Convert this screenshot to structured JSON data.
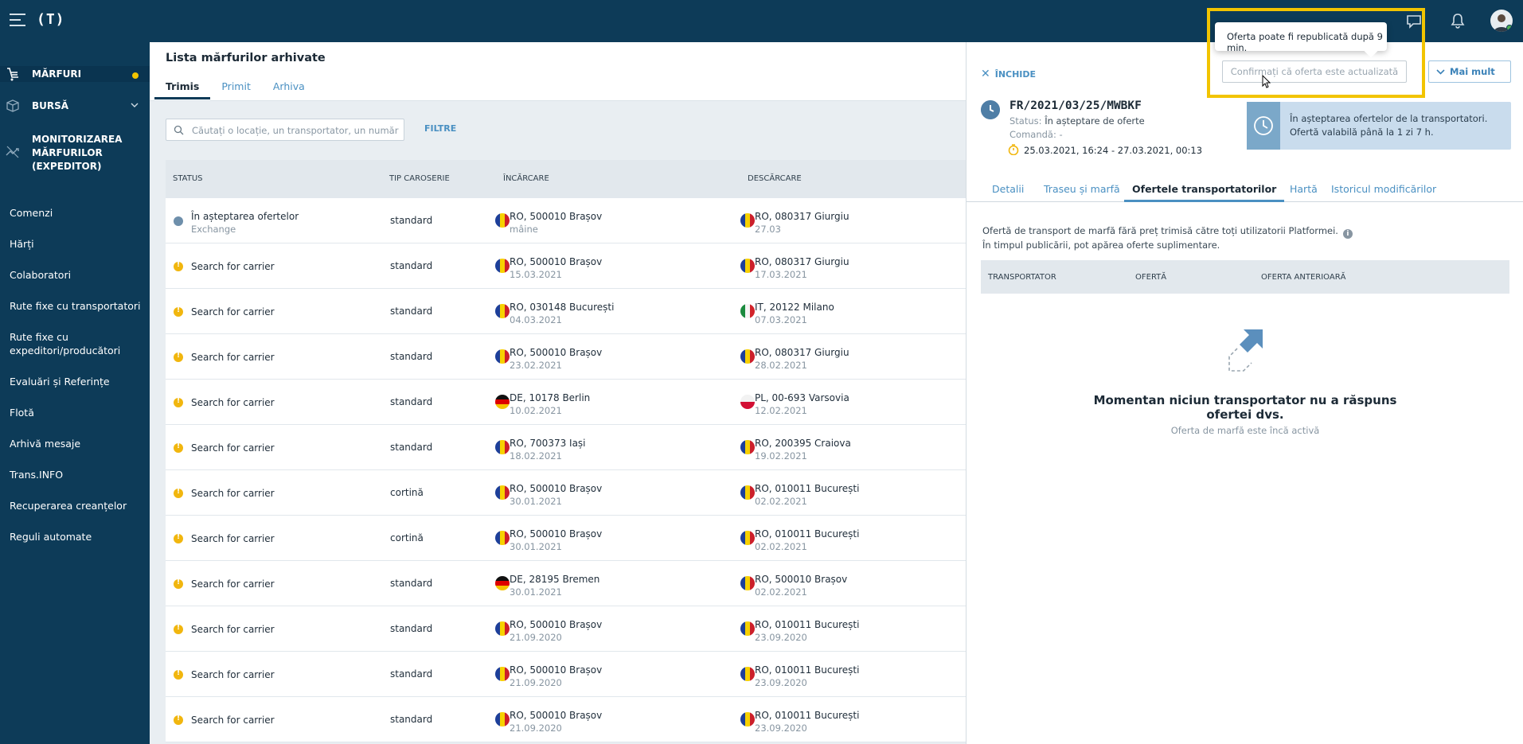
{
  "app": {
    "logo": "(T)"
  },
  "sidebar": {
    "main": [
      {
        "label": "MĂRFURI"
      },
      {
        "label": "BURSĂ"
      },
      {
        "label": "MONITORIZAREA MĂRFURILOR (EXPEDITOR)"
      }
    ],
    "items": [
      {
        "label": "Comenzi"
      },
      {
        "label": "Hărți"
      },
      {
        "label": "Colaboratori"
      },
      {
        "label": "Rute fixe cu transportatori"
      },
      {
        "label": "Rute fixe cu expeditori/producători"
      },
      {
        "label": "Evaluări și Referințe"
      },
      {
        "label": "Flotă"
      },
      {
        "label": "Arhivă mesaje"
      },
      {
        "label": "Trans.INFO"
      },
      {
        "label": "Recuperarea creanțelor"
      },
      {
        "label": "Reguli automate"
      }
    ]
  },
  "main": {
    "title": "Lista mărfurilor arhivate",
    "tabs": [
      "Trimis",
      "Primit",
      "Arhiva"
    ],
    "search_placeholder": "Căutați o locație, un transportator, un număr de...",
    "filter_label": "FILTRE",
    "columns": [
      "STATUS",
      "TIP CAROSERIE",
      "ÎNCĂRCARE",
      "DESCĂRCARE"
    ],
    "rows": [
      {
        "status": "În așteptarea ofertelor",
        "status_sub": "Exchange",
        "body": "standard",
        "load": "RO, 500010 Brașov",
        "load_date": "mâine",
        "unload": "RO, 080317 Giurgiu",
        "unload_date": "27.03"
      },
      {
        "status": "Search for carrier",
        "body": "standard",
        "load": "RO, 500010 Brașov",
        "load_date": "15.03.2021",
        "unload": "RO, 080317 Giurgiu",
        "unload_date": "17.03.2021"
      },
      {
        "status": "Search for carrier",
        "body": "standard",
        "load": "RO, 030148 București",
        "load_date": "04.03.2021",
        "unload": "IT, 20122 Milano",
        "unload_date": "07.03.2021"
      },
      {
        "status": "Search for carrier",
        "body": "standard",
        "load": "RO, 500010 Brașov",
        "load_date": "23.02.2021",
        "unload": "RO, 080317 Giurgiu",
        "unload_date": "28.02.2021"
      },
      {
        "status": "Search for carrier",
        "body": "standard",
        "load": "DE, 10178 Berlin",
        "load_date": "10.02.2021",
        "unload": "PL, 00-693 Varsovia",
        "unload_date": "12.02.2021"
      },
      {
        "status": "Search for carrier",
        "body": "standard",
        "load": "RO, 700373 Iași",
        "load_date": "18.02.2021",
        "unload": "RO, 200395 Craiova",
        "unload_date": "19.02.2021"
      },
      {
        "status": "Search for carrier",
        "body": "cortină",
        "load": "RO, 500010 Brașov",
        "load_date": "30.01.2021",
        "unload": "RO, 010011 București",
        "unload_date": "02.02.2021"
      },
      {
        "status": "Search for carrier",
        "body": "cortină",
        "load": "RO, 500010 Brașov",
        "load_date": "30.01.2021",
        "unload": "RO, 010011 București",
        "unload_date": "02.02.2021"
      },
      {
        "status": "Search for carrier",
        "body": "standard",
        "load": "DE, 28195 Bremen",
        "load_date": "30.01.2021",
        "unload": "RO, 500010 Brașov",
        "unload_date": "02.02.2021"
      },
      {
        "status": "Search for carrier",
        "body": "standard",
        "load": "RO, 500010 Brașov",
        "load_date": "21.09.2020",
        "unload": "RO, 010011 București",
        "unload_date": "23.09.2020"
      },
      {
        "status": "Search for carrier",
        "body": "standard",
        "load": "RO, 500010 Brașov",
        "load_date": "21.09.2020",
        "unload": "RO, 010011 București",
        "unload_date": "23.09.2020"
      },
      {
        "status": "Search for carrier",
        "body": "standard",
        "load": "RO, 500010 Brașov",
        "load_date": "21.09.2020",
        "unload": "RO, 010011 București",
        "unload_date": "23.09.2020"
      }
    ]
  },
  "panel": {
    "close_label": "ÎNCHIDE",
    "confirm_label": "Confirmați că oferta este actualizată",
    "more_label": "Mai mult",
    "tooltip": "Oferta poate fi republicată după 9 min.",
    "reference": "FR/2021/03/25/MWBKF",
    "status_key": "Status:",
    "status_val": "În așteptare de oferte",
    "order_key": "Comandă:",
    "order_val": "-",
    "period": "25.03.2021, 16:24 - 27.03.2021, 00:13",
    "info_line1": "În așteptarea ofertelor de la transportatori.",
    "info_line2": "Ofertă valabilă până la 1 zi 7 h.",
    "tabs": [
      "Detalii",
      "Traseu și marfă",
      "Ofertele transportatorilor",
      "Hartă",
      "Istoricul modificărilor"
    ],
    "note_line1": "Ofertă de transport de marfă fără preț trimisă către toți utilizatorii Platformei.",
    "note_line2": "În timpul publicării, pot apărea oferte suplimentare.",
    "offer_columns": [
      "TRANSPORTATOR",
      "OFERTĂ",
      "OFERTA ANTERIOARĂ"
    ],
    "empty_title": "Momentan niciun transportator nu a răspuns ofertei dvs.",
    "empty_sub": "Oferta de marfă este încă activă"
  },
  "colors": {
    "navy": "#0d3b58",
    "accent": "#4a90c2",
    "warning": "#f1b60e",
    "highlight": "#f2c400"
  },
  "icons": [
    "menu-icon",
    "chat-icon",
    "bell-icon",
    "search-icon",
    "clock-icon",
    "info-icon",
    "arrow-icon"
  ]
}
